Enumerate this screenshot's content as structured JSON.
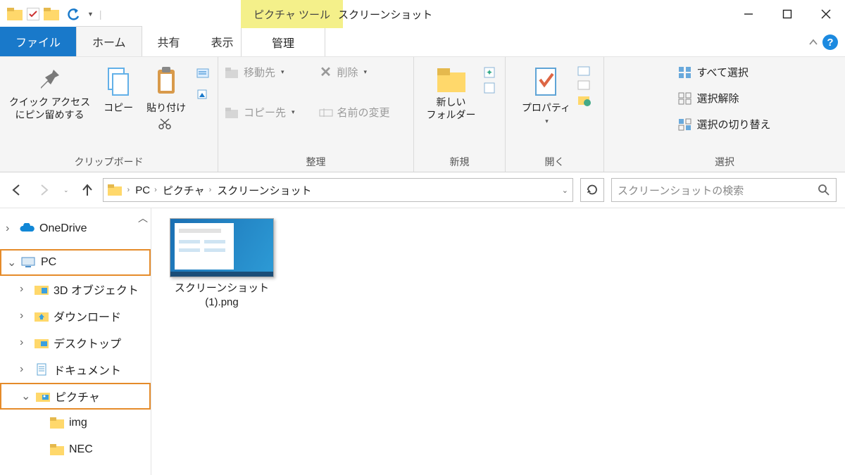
{
  "title": "スクリーンショット",
  "context_tab": "ピクチャ ツール",
  "tabs": {
    "file": "ファイル",
    "home": "ホーム",
    "share": "共有",
    "view": "表示",
    "manage": "管理"
  },
  "ribbon": {
    "clipboard": {
      "pin": "クイック アクセス\nにピン留めする",
      "copy": "コピー",
      "paste": "貼り付け",
      "label": "クリップボード"
    },
    "organize": {
      "move": "移動先",
      "copyto": "コピー先",
      "delete": "削除",
      "rename": "名前の変更",
      "label": "整理"
    },
    "new": {
      "folder": "新しい\nフォルダー",
      "label": "新規"
    },
    "open": {
      "props": "プロパティ",
      "label": "開く"
    },
    "select": {
      "all": "すべて選択",
      "none": "選択解除",
      "invert": "選択の切り替え",
      "label": "選択"
    }
  },
  "breadcrumbs": [
    "PC",
    "ピクチャ",
    "スクリーンショット"
  ],
  "search_placeholder": "スクリーンショットの検索",
  "tree": {
    "onedrive": "OneDrive",
    "pc": "PC",
    "pc_children": [
      "3D オブジェクト",
      "ダウンロード",
      "デスクトップ",
      "ドキュメント"
    ],
    "pictures": "ピクチャ",
    "pictures_children": [
      "img",
      "NEC"
    ]
  },
  "file": {
    "name": "スクリーンショット\n(1).png"
  }
}
